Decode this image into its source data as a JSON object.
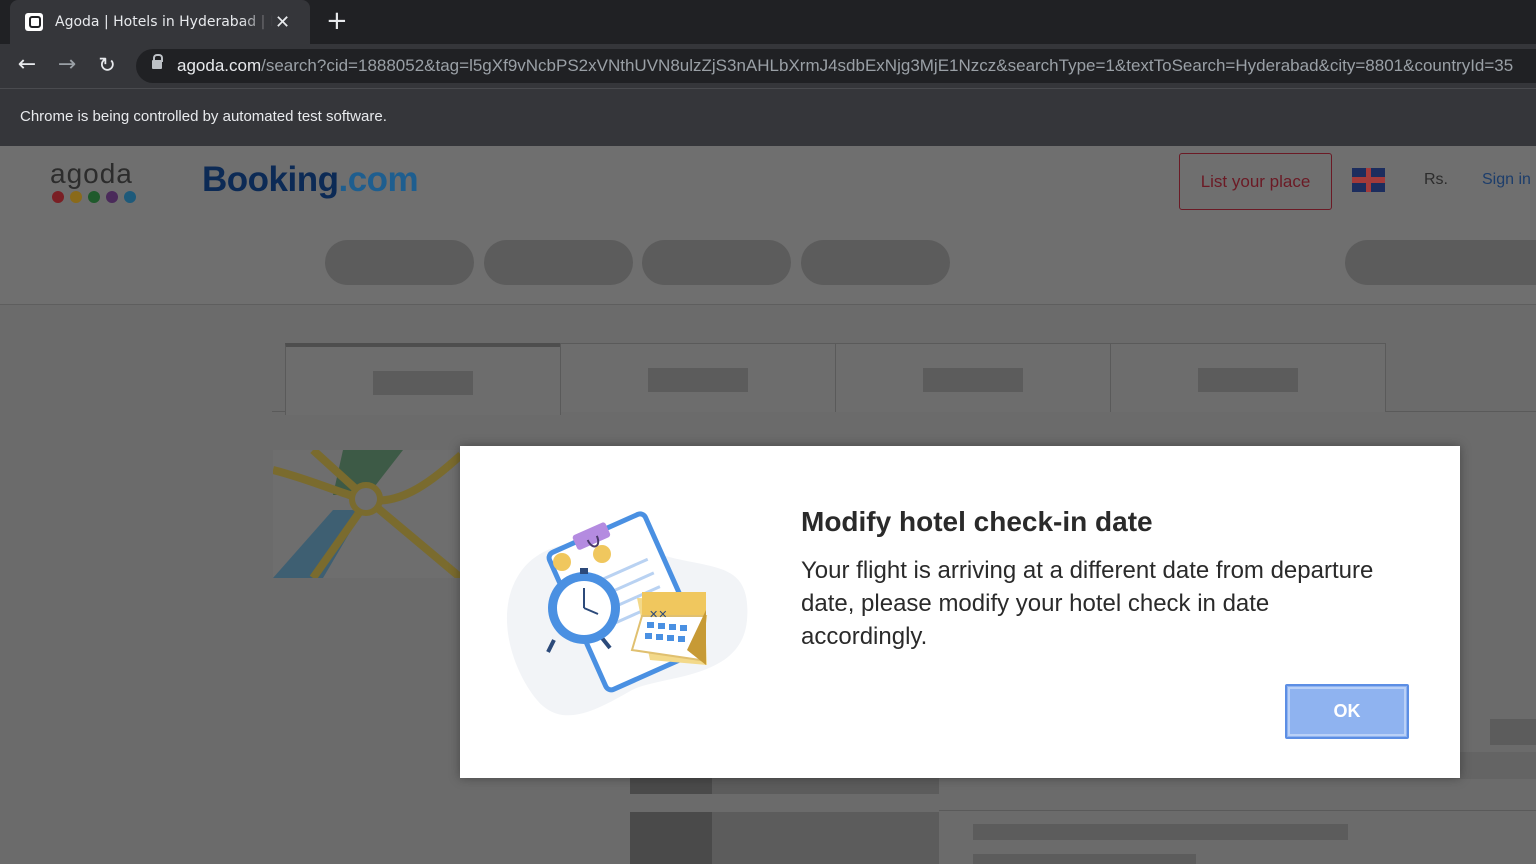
{
  "browser": {
    "tab_title": "Agoda | Hotels in Hyderabad | Best Price Guarantee",
    "url_host": "agoda.com",
    "url_path": "/search?cid=1888052&tag=l5gXf9vNcbPS2xVNthUVN8ulzZjS3nAHLbXrmJ4sdbExNjg3MjE1Nzcz&searchType=1&textToSearch=Hyderabad&city=8801&countryId=35",
    "infobar_text": "Chrome is being controlled by automated test software.",
    "icons": [
      "agoda-favicon",
      "close-icon",
      "plus-icon",
      "back-arrow-icon",
      "forward-arrow-icon",
      "reload-icon",
      "lock-icon"
    ]
  },
  "header": {
    "agoda_logo_text": "agoda",
    "agoda_dot_colors": [
      "#7a1f24",
      "#8a6a1a",
      "#1f5a2c",
      "#4a2a5a",
      "#1e5a7a"
    ],
    "booking_logo_main": "Booking",
    "booking_logo_suffix": ".com",
    "list_place_label": "List your place",
    "currency": "Rs.",
    "signin_label": "Sign in"
  },
  "modal": {
    "title": "Modify hotel check-in date",
    "message": "Your flight is arriving at a different date from departure date, please modify your hotel check in date accordingly.",
    "ok_label": "OK",
    "illustration": "calendar-clock-checklist-illustration"
  },
  "colors": {
    "overlay_dim": "#6b6b6b",
    "ok_button": "#8fb3f0",
    "modal_bg": "#ffffff"
  }
}
